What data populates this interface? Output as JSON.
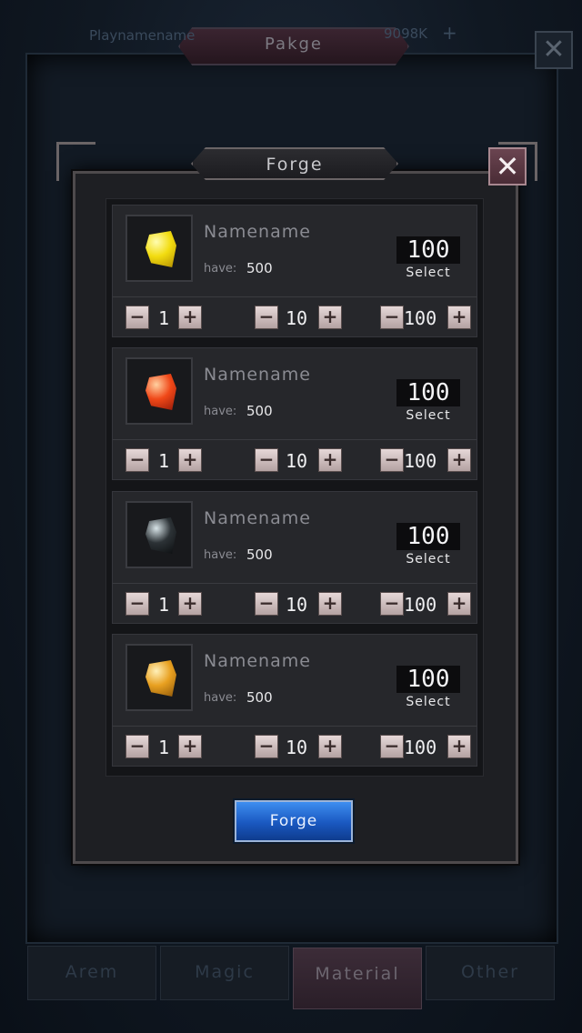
{
  "background_window": {
    "player_name": "Playnamename",
    "currency": "9098K",
    "add_symbol": "+",
    "title": "Pakge",
    "close_symbol": "✕",
    "tabs": [
      "Arem",
      "Magic",
      "Material",
      "Other"
    ],
    "active_tab": "Material"
  },
  "dialog": {
    "title": "Forge",
    "close_symbol": "✕",
    "confirm_label": "Forge"
  },
  "items": [
    {
      "name": "Namename",
      "have_label": "have:",
      "have_value": "500",
      "count": "100",
      "select_label": "Select",
      "gem_color": "yellow",
      "steps": [
        {
          "minus": "−",
          "value": "1",
          "plus": "+"
        },
        {
          "minus": "−",
          "value": "10",
          "plus": "+"
        },
        {
          "minus": "−",
          "value": "100",
          "plus": "+"
        }
      ]
    },
    {
      "name": "Namename",
      "have_label": "have:",
      "have_value": "500",
      "count": "100",
      "select_label": "Select",
      "gem_color": "red",
      "steps": [
        {
          "minus": "−",
          "value": "1",
          "plus": "+"
        },
        {
          "minus": "−",
          "value": "10",
          "plus": "+"
        },
        {
          "minus": "−",
          "value": "100",
          "plus": "+"
        }
      ]
    },
    {
      "name": "Namename",
      "have_label": "have:",
      "have_value": "500",
      "count": "100",
      "select_label": "Select",
      "gem_color": "black",
      "steps": [
        {
          "minus": "−",
          "value": "1",
          "plus": "+"
        },
        {
          "minus": "−",
          "value": "10",
          "plus": "+"
        },
        {
          "minus": "−",
          "value": "100",
          "plus": "+"
        }
      ]
    },
    {
      "name": "Namename",
      "have_label": "have:",
      "have_value": "500",
      "count": "100",
      "select_label": "Select",
      "gem_color": "orange",
      "steps": [
        {
          "minus": "−",
          "value": "1",
          "plus": "+"
        },
        {
          "minus": "−",
          "value": "10",
          "plus": "+"
        },
        {
          "minus": "−",
          "value": "100",
          "plus": "+"
        }
      ]
    }
  ],
  "colors": {
    "accent_blue": "#1a58c0",
    "panel": "#26272b",
    "stepper_button": "#d8c8c8"
  }
}
